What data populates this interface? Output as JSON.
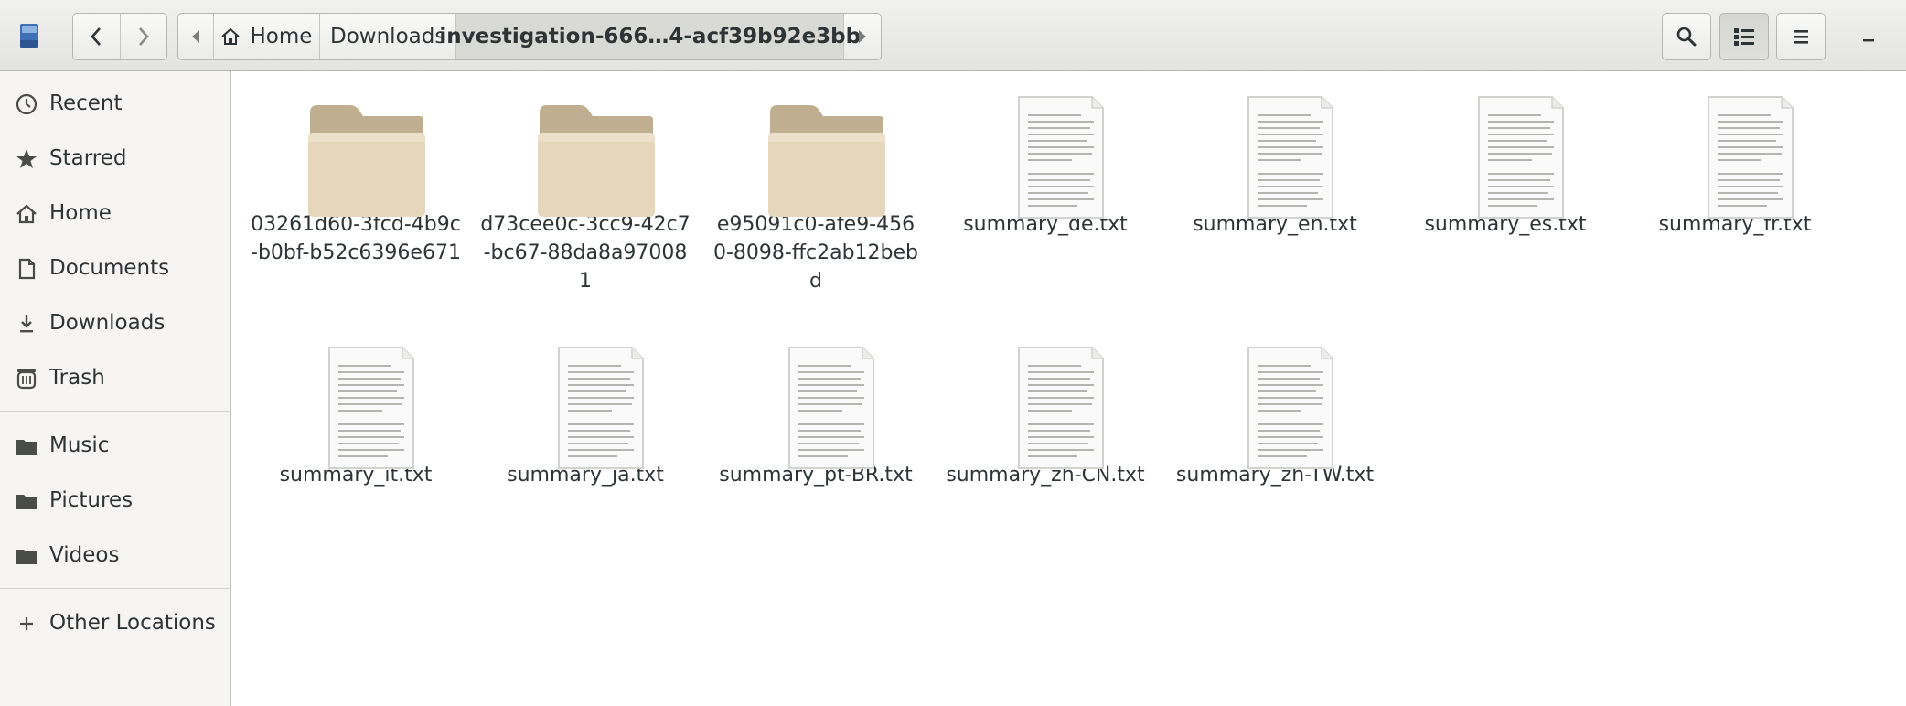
{
  "window": {
    "back_tooltip": "back",
    "forward_tooltip": "forward"
  },
  "pathbar": {
    "home": "Home",
    "downloads": "Downloads",
    "current": "investigation-666…4-acf39b92e3bb"
  },
  "sidebar": {
    "items": [
      {
        "label": "Recent",
        "icon": "clock-icon"
      },
      {
        "label": "Starred",
        "icon": "star-icon"
      },
      {
        "label": "Home",
        "icon": "home-icon"
      },
      {
        "label": "Documents",
        "icon": "document-icon"
      },
      {
        "label": "Downloads",
        "icon": "download-icon"
      },
      {
        "label": "Trash",
        "icon": "trash-icon"
      },
      {
        "label": "Music",
        "icon": "folder-icon"
      },
      {
        "label": "Pictures",
        "icon": "folder-icon"
      },
      {
        "label": "Videos",
        "icon": "folder-icon"
      },
      {
        "label": "Other Locations",
        "icon": "plus-icon"
      }
    ]
  },
  "files": [
    {
      "name": "03261d60-3fcd-4b9c-b0bf-b52c6396e671",
      "type": "folder"
    },
    {
      "name": "d73cee0c-3cc9-42c7-bc67-88da8a970081",
      "type": "folder"
    },
    {
      "name": "e95091c0-afe9-4560-8098-ffc2ab12bebd",
      "type": "folder"
    },
    {
      "name": "summary_de.txt",
      "type": "text"
    },
    {
      "name": "summary_en.txt",
      "type": "text"
    },
    {
      "name": "summary_es.txt",
      "type": "text"
    },
    {
      "name": "summary_fr.txt",
      "type": "text"
    },
    {
      "name": "summary_it.txt",
      "type": "text"
    },
    {
      "name": "summary_ja.txt",
      "type": "text"
    },
    {
      "name": "summary_pt-BR.txt",
      "type": "text"
    },
    {
      "name": "summary_zh-CN.txt",
      "type": "text"
    },
    {
      "name": "summary_zh-TW.txt",
      "type": "text"
    }
  ],
  "colors": {
    "folder_tab": "#bfae8f",
    "folder_front": "#e6d6bb",
    "headerbar": "#e8e8e7",
    "sidebar_bg": "#f6f5f4"
  }
}
